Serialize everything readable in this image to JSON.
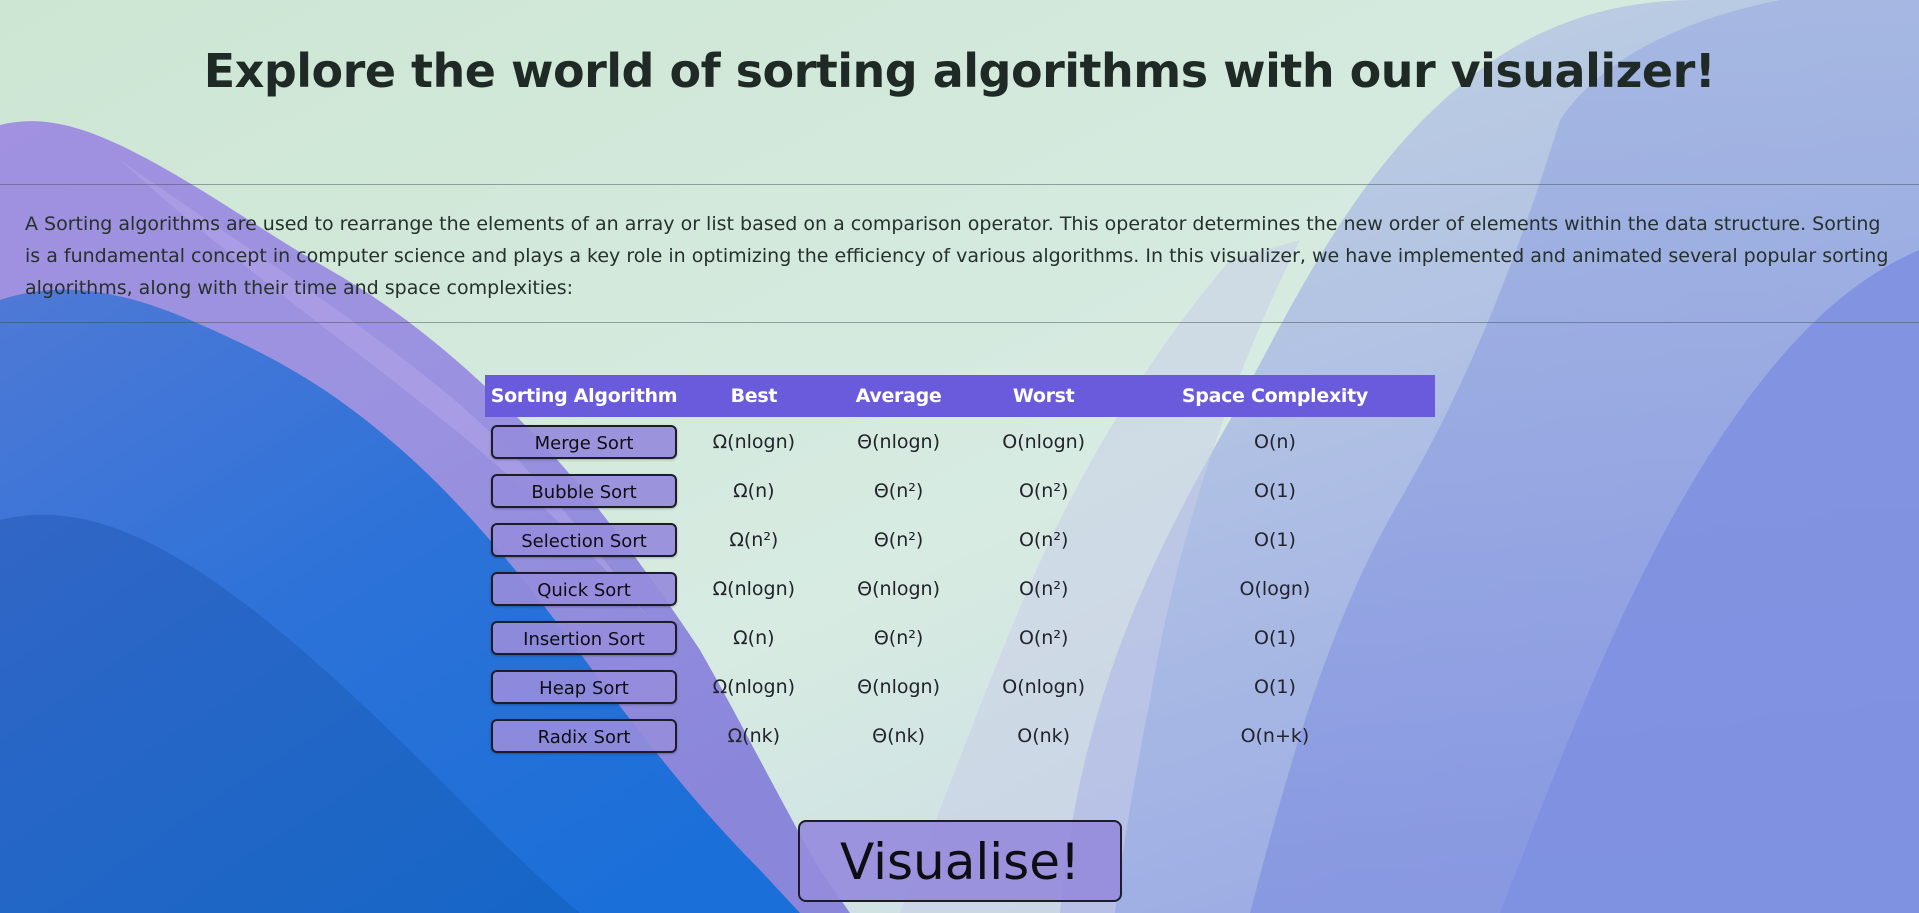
{
  "page": {
    "title": "Explore the world of sorting algorithms with our visualizer!",
    "intro": "A Sorting algorithms are used to rearrange the elements of an array or list based on a comparison operator. This operator determines the new order of elements within the data structure. Sorting is a fundamental concept in computer science and plays a key role in optimizing the efficiency of various algorithms. In this visualizer, we have implemented and animated several popular sorting algorithms, along with their time and space complexities:"
  },
  "colors": {
    "header_bg": "#6a5bdc",
    "button_bg": "#968cdc",
    "title_text": "#1f2a26"
  },
  "table": {
    "headers": [
      "Sorting Algorithm",
      "Best",
      "Average",
      "Worst",
      "Space Complexity"
    ],
    "rows": [
      {
        "algorithm": "Merge Sort",
        "best": "Ω(nlogn)",
        "average": "Θ(nlogn)",
        "worst": "O(nlogn)",
        "space": "O(n)"
      },
      {
        "algorithm": "Bubble Sort",
        "best": "Ω(n)",
        "average": "Θ(n²)",
        "worst": "O(n²)",
        "space": "O(1)"
      },
      {
        "algorithm": "Selection Sort",
        "best": "Ω(n²)",
        "average": "Θ(n²)",
        "worst": "O(n²)",
        "space": "O(1)"
      },
      {
        "algorithm": "Quick Sort",
        "best": "Ω(nlogn)",
        "average": "Θ(nlogn)",
        "worst": "O(n²)",
        "space": "O(logn)"
      },
      {
        "algorithm": "Insertion Sort",
        "best": "Ω(n)",
        "average": "Θ(n²)",
        "worst": "O(n²)",
        "space": "O(1)"
      },
      {
        "algorithm": "Heap Sort",
        "best": "Ω(nlogn)",
        "average": "Θ(nlogn)",
        "worst": "O(nlogn)",
        "space": "O(1)"
      },
      {
        "algorithm": "Radix Sort",
        "best": "Ω(nk)",
        "average": "Θ(nk)",
        "worst": "O(nk)",
        "space": "O(n+k)"
      }
    ]
  },
  "actions": {
    "visualise_label": "Visualise!"
  }
}
